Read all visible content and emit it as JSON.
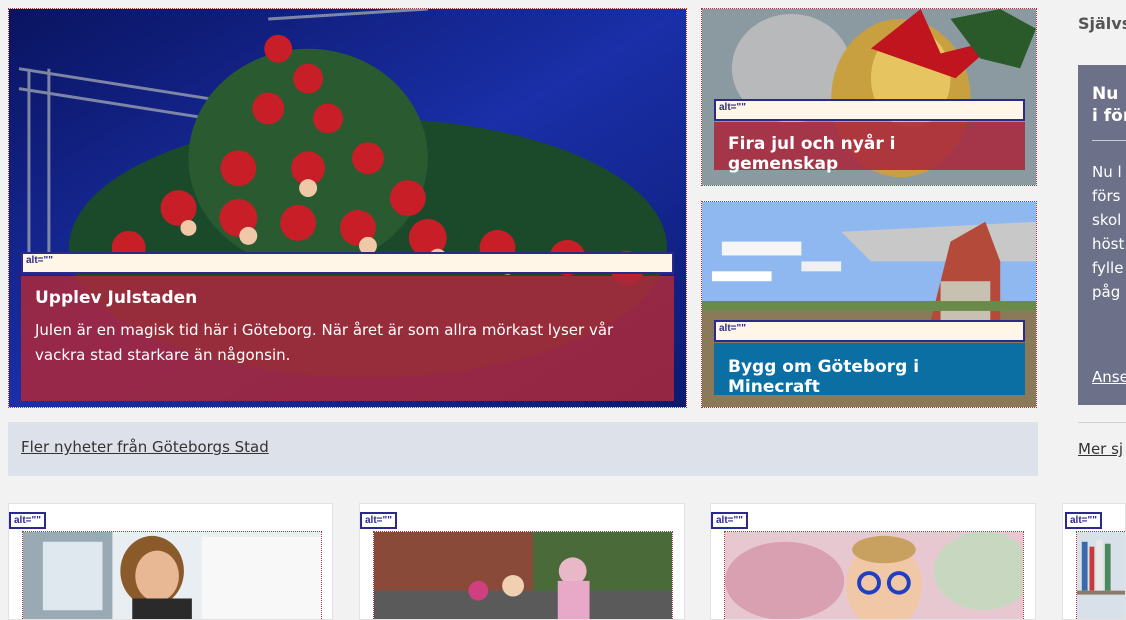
{
  "featured": {
    "main": {
      "alt_label": "alt=\"\"",
      "title": "Upplev Julstaden",
      "text": "Julen är en magisk tid här i Göteborg. När året är som allra mörkast lyser vår vackra stad starkare än någonsin."
    },
    "top_right": {
      "alt_label": "alt=\"\"",
      "title": "Fira jul och nyår i gemenskap"
    },
    "bottom_right": {
      "alt_label": "alt=\"\"",
      "title": "Bygg om Göteborg i Minecraft"
    }
  },
  "more_news_link": "Fler nyheter från Göteborgs Stad",
  "sidebar": {
    "heading": "Självs",
    "panel_title": "Nu\ni för",
    "panel_text_lines": [
      "Nu l",
      "förs",
      "skol",
      "höst",
      "fylle",
      "påg"
    ],
    "panel_link": "Anse",
    "more_link": "Mer sj"
  },
  "cards": [
    {
      "alt_label": "alt=\"\""
    },
    {
      "alt_label": "alt=\"\""
    },
    {
      "alt_label": "alt=\"\""
    },
    {
      "alt_label": "alt=\"\""
    }
  ],
  "colors": {
    "caption_red": "#a8283c",
    "caption_blue": "#006eaa",
    "side_panel": "#6c7189",
    "bar": "#dde1ea"
  }
}
